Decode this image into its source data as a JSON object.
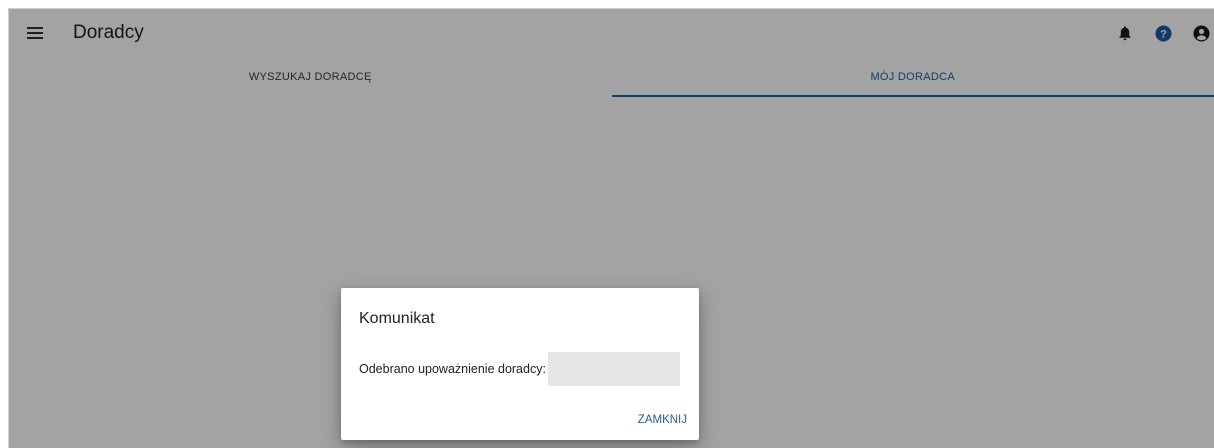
{
  "appbar": {
    "title": "Doradcy",
    "icons": [
      "menu-icon",
      "bell-icon",
      "help-icon",
      "account-icon"
    ]
  },
  "tabs": [
    {
      "label": "WYSZUKAJ DORADCĘ",
      "active": false
    },
    {
      "label": "MÓJ DORADCA",
      "active": true
    }
  ],
  "dialog": {
    "title": "Komunikat",
    "message_label": "Odebrano upoważnienie doradcy:",
    "message_value": "",
    "close_label": "ZAMKNIJ"
  },
  "colors": {
    "accent": "#2a5aa0",
    "scrim": "rgba(0,0,0,0.36)",
    "help_icon": "#1e5aa6"
  }
}
